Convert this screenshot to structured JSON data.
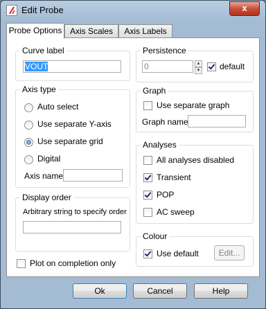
{
  "window": {
    "title": "Edit Probe",
    "close_label": "x"
  },
  "tabs": [
    {
      "label": "Probe Options"
    },
    {
      "label": "Axis Scales"
    },
    {
      "label": "Axis Labels"
    }
  ],
  "curve_label": {
    "title": "Curve label",
    "value": "VOUT"
  },
  "axis_type": {
    "title": "Axis type",
    "options": [
      {
        "label": "Auto select",
        "selected": false
      },
      {
        "label": "Use separate Y-axis",
        "selected": false
      },
      {
        "label": "Use separate grid",
        "selected": true
      },
      {
        "label": "Digital",
        "selected": false
      }
    ],
    "axis_name_label": "Axis name",
    "axis_name_value": ""
  },
  "display_order": {
    "title": "Display order",
    "description": "Arbitrary string to specify order",
    "value": ""
  },
  "plot_on_completion": {
    "label": "Plot on completion only",
    "checked": false
  },
  "persistence": {
    "title": "Persistence",
    "value": "0",
    "default_label": "default",
    "default_checked": true
  },
  "graph": {
    "title": "Graph",
    "separate_label": "Use separate graph",
    "separate_checked": false,
    "name_label": "Graph name",
    "name_value": ""
  },
  "analyses": {
    "title": "Analyses",
    "items": [
      {
        "label": "All analyses disabled",
        "checked": false
      },
      {
        "label": "Transient",
        "checked": true
      },
      {
        "label": "POP",
        "checked": true
      },
      {
        "label": "AC sweep",
        "checked": false
      }
    ]
  },
  "colour": {
    "title": "Colour",
    "use_default_label": "Use default",
    "use_default_checked": true,
    "edit_label": "Edit..."
  },
  "footer": {
    "ok_label": "Ok",
    "cancel_label": "Cancel",
    "help_label": "Help"
  }
}
